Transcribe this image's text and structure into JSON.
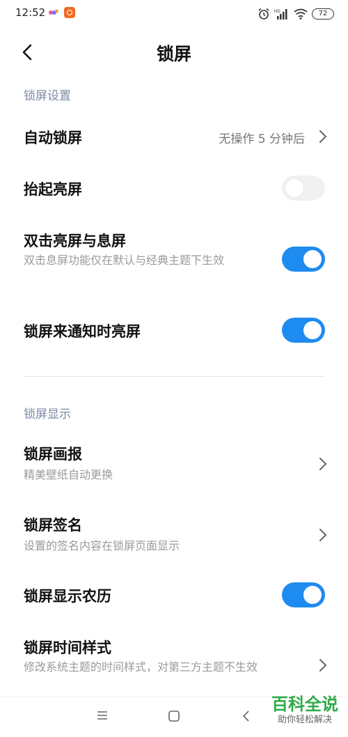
{
  "status_bar": {
    "time": "12:52",
    "battery": "72",
    "icons": [
      "app-notification-icon",
      "app-orange-icon",
      "alarm-icon",
      "signal-icon",
      "wifi-icon",
      "battery-icon"
    ]
  },
  "header": {
    "title": "锁屏"
  },
  "sections": {
    "lock_settings": {
      "title": "锁屏设置",
      "auto_lock": {
        "label": "自动锁屏",
        "value": "无操作 5 分钟后"
      },
      "raise_to_wake": {
        "label": "抬起亮屏",
        "enabled": false
      },
      "double_tap": {
        "label": "双击亮屏与息屏",
        "sub": "双击息屏功能仅在默认与经典主题下生效",
        "enabled": true
      },
      "notif_wake": {
        "label": "锁屏来通知时亮屏",
        "enabled": true
      }
    },
    "lock_display": {
      "title": "锁屏显示",
      "wallpaper": {
        "label": "锁屏画报",
        "sub": "精美壁纸自动更换"
      },
      "signature": {
        "label": "锁屏签名",
        "sub": "设置的签名内容在锁屏页面显示"
      },
      "lunar": {
        "label": "锁屏显示农历",
        "enabled": true
      },
      "clock_style": {
        "label": "锁屏时间样式",
        "sub": "修改系统主题的时间样式，对第三方主题不生效"
      }
    }
  },
  "watermark": {
    "title": "百科全说",
    "subtitle": "助你轻松解决"
  },
  "colors": {
    "accent": "#1e8bf0",
    "section_header": "#7d8aa6",
    "watermark": "#2eaa4a"
  }
}
